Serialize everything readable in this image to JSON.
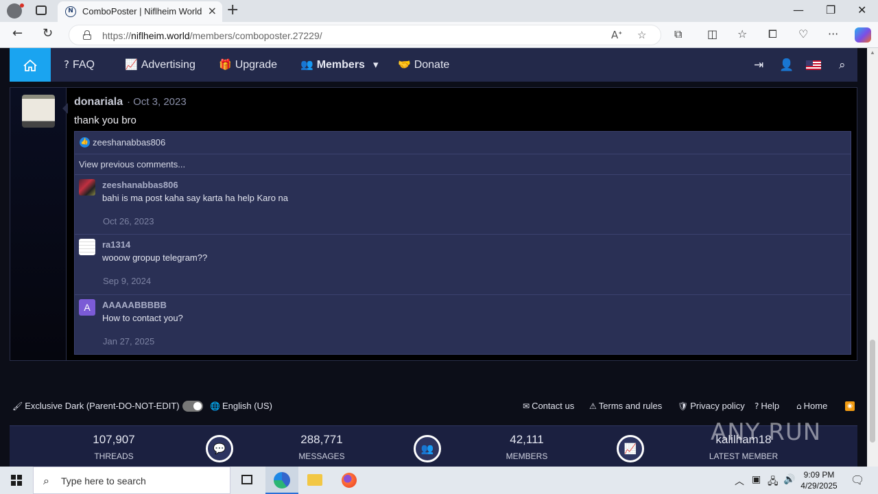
{
  "browser": {
    "tab_title": "ComboPoster | Niflheim World",
    "favicon_letter": "N",
    "url_prefix": "https://",
    "url_host": "niflheim.world",
    "url_path": "/members/comboposter.27229/"
  },
  "nav": {
    "items": [
      "FAQ",
      "Advertising",
      "Upgrade",
      "Members",
      "Donate"
    ]
  },
  "post": {
    "author": "donariala",
    "date": "· Oct 3, 2023",
    "text": "thank you bro",
    "reaction_user": "zeeshanabbas806",
    "view_previous": "View previous comments...",
    "comments": [
      {
        "name": "zeeshanabbas806",
        "text": "bahi is ma post kaha say karta ha help Karo na",
        "date": "Oct 26, 2023"
      },
      {
        "name": "ra1314",
        "text": "wooow gropup telegram??",
        "date": "Sep 9, 2024"
      },
      {
        "name": "AAAAABBBBB",
        "text": "How to contact you?",
        "date": "Jan 27, 2025",
        "avatar_letter": "A"
      }
    ]
  },
  "footer": {
    "style": "Exclusive Dark (Parent-DO-NOT-EDIT)",
    "language": "English (US)",
    "links": [
      "Contact us",
      "Terms and rules",
      "Privacy policy",
      "Help",
      "Home"
    ]
  },
  "stats": [
    {
      "value": "107,907",
      "label": "THREADS"
    },
    {
      "value": "288,771",
      "label": "MESSAGES"
    },
    {
      "value": "42,111",
      "label": "MEMBERS"
    },
    {
      "value": "kalilham18",
      "label": "LATEST MEMBER"
    }
  ],
  "watermark": "ANY RUN",
  "taskbar": {
    "search_placeholder": "Type here to search",
    "time": "9:09 PM",
    "date": "4/29/2025"
  },
  "colors": {
    "accent": "#1aa4f0",
    "navbar": "#23294a",
    "comment_bg": "#2a3055"
  }
}
